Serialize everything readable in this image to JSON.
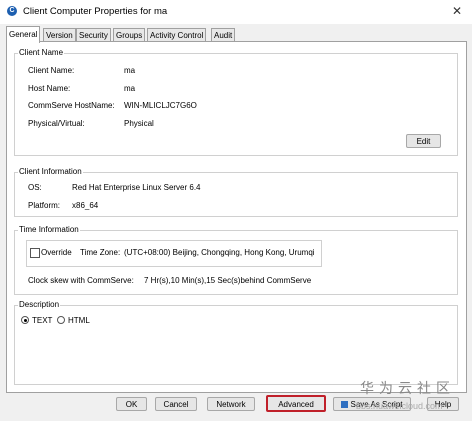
{
  "window": {
    "title": "Client Computer Properties for ma",
    "close_glyph": "✕",
    "app_icon": "commvault-icon"
  },
  "tabs": [
    {
      "label": "General",
      "active": true
    },
    {
      "label": "Version"
    },
    {
      "label": "Security"
    },
    {
      "label": "Groups"
    },
    {
      "label": "Activity Control"
    },
    {
      "label": "Audit"
    }
  ],
  "client_name_group": {
    "legend": "Client Name",
    "rows": [
      {
        "label": "Client Name:",
        "value": "ma"
      },
      {
        "label": "Host Name:",
        "value": "ma"
      },
      {
        "label": "CommServe HostName:",
        "value": "WIN-MLICLJC7G6O"
      },
      {
        "label": "Physical/Virtual:",
        "value": "Physical"
      }
    ],
    "edit_label": "Edit"
  },
  "client_info_group": {
    "legend": "Client Information",
    "rows": [
      {
        "label": "OS:",
        "value": "Red Hat Enterprise Linux Server 6.4"
      },
      {
        "label": "Platform:",
        "value": "x86_64"
      }
    ]
  },
  "time_group": {
    "legend": "Time Information",
    "override_label": "Override",
    "override_checked": false,
    "timezone_label": "Time Zone:",
    "timezone_value": "(UTC+08:00) Beijing, Chongqing, Hong Kong, Urumqi",
    "clock_skew_label": "Clock skew with CommServe:",
    "clock_skew_value": "7 Hr(s),10 Min(s),15 Sec(s)behind CommServe"
  },
  "description_group": {
    "legend": "Description",
    "options": [
      {
        "label": "TEXT",
        "selected": true
      },
      {
        "label": "HTML",
        "selected": false
      }
    ]
  },
  "buttons": {
    "ok": "OK",
    "cancel": "Cancel",
    "network": "Network",
    "advanced": "Advanced",
    "save_as_script": "Save As Script",
    "help": "Help"
  },
  "highlight_color": "#c0202a",
  "watermark": {
    "text": "华为云社区",
    "url": "bbs.huaweicloud.com"
  }
}
